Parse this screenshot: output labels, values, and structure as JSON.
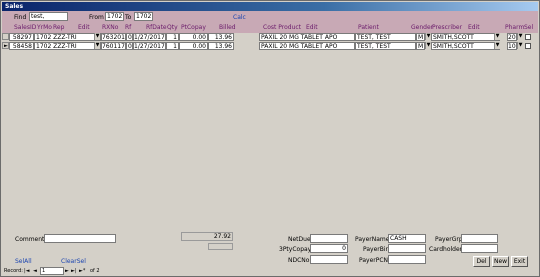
{
  "window": {
    "title": "Sales"
  },
  "filter": {
    "find_label": "Find",
    "find_value": "test,",
    "from_label": "From",
    "from_value": "1702",
    "to_label": "To",
    "to_value": "1702",
    "calc_label": "Calc"
  },
  "columns": {
    "salesid": "SalesID",
    "yrmo": "YrMo",
    "rep": "Rep",
    "edit1": "Edit",
    "rxno": "RXNo",
    "rf": "Rf",
    "rfdate": "RfDate",
    "qty": "Qty",
    "ptcopay": "PtCopay",
    "billed": "Billed",
    "cost_product": "Cost Product",
    "edit2": "Edit",
    "patient": "Patient",
    "gender": "Gender",
    "prescriber": "Prescriber",
    "edit3": "Edit",
    "pharm": "Pharm",
    "sel": "Sel"
  },
  "rows": [
    {
      "salesid": "58297",
      "yrmo_rep": "1702 ZZZ-TRI",
      "rxno": "7632015",
      "rf": "0",
      "rfdate": "1/27/2017",
      "qty": "1",
      "ptcopay": "0.00",
      "billed": "13.96",
      "product": "PAXIL 20 MG TABLET APO",
      "patient": "TEST, TEST",
      "gender": "M",
      "prescriber": "SMITH,SCOTT",
      "pharm": "20"
    },
    {
      "salesid": "58458",
      "yrmo_rep": "1702 ZZZ-TRI",
      "rxno": "7601176",
      "rf": "0",
      "rfdate": "1/27/2017",
      "qty": "1",
      "ptcopay": "0.00",
      "billed": "13.96",
      "product": "PAXIL 20 MG TABLET APO",
      "patient": "TEST, TEST",
      "gender": "M",
      "prescriber": "SMITH,SCOTT",
      "pharm": "10"
    }
  ],
  "footer": {
    "comment_label": "Comment",
    "comment_value": "",
    "total_value": "27.92",
    "netdue_label": "NetDue",
    "netdue_value": "",
    "thirdparty_label": "3PtyCopay",
    "thirdparty_value": "0",
    "ndcno_label": "NDCNo",
    "ndcno_value": "",
    "payername_label": "PayerName",
    "payername_value": "CASH",
    "payerbin_label": "PayerBin",
    "payerbin_value": "",
    "payerpcn_label": "PayerPCN",
    "payerpcn_value": "",
    "payergrp_label": "PayerGrp",
    "payergrp_value": "",
    "cardholder_label": "Cardholder",
    "cardholder_value": "",
    "selall_label": "SelAll",
    "clearsel_label": "ClearSel",
    "del_label": "Del",
    "new_label": "New",
    "exit_label": "Exit"
  },
  "nav": {
    "record_label": "Record:",
    "first_glyph": "|◄",
    "prev_glyph": "◄",
    "current": "1",
    "next_glyph": "►",
    "last_glyph": "►|",
    "new_glyph": "►*",
    "of_text": "of 2"
  },
  "icons": {
    "dropdown": "chevron-down-icon",
    "record_pointer": "record-pointer-icon"
  },
  "colors": {
    "header_bg": "#c8a9b5",
    "form_bg": "#d4d0c8",
    "title_bar": "#0a246a",
    "link_blue": "#1a44b0"
  }
}
